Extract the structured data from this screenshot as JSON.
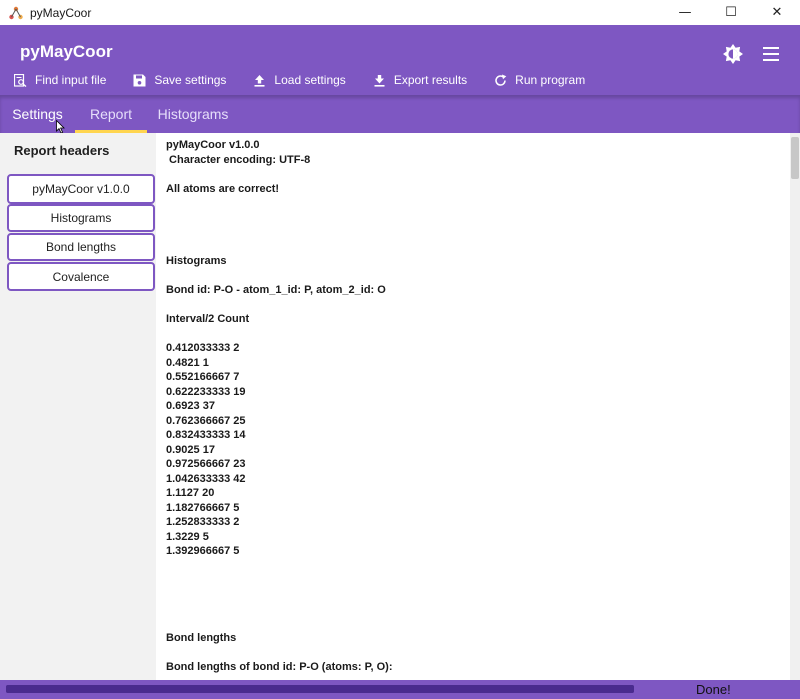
{
  "window": {
    "title": "pyMayCoor",
    "controls": [
      "—",
      "☐",
      "✕"
    ]
  },
  "header": {
    "title": "pyMayCoor",
    "theme_icon": "brightness-icon",
    "menu_icon": "hamburger-menu-icon",
    "accent_color": "#7e57c2"
  },
  "toolbar": {
    "find_label": "Find input file",
    "save_label": "Save settings",
    "load_label": "Load settings",
    "export_label": "Export results",
    "run_label": "Run program"
  },
  "tabs": [
    {
      "label": "Settings"
    },
    {
      "label": "Report"
    },
    {
      "label": "Histograms"
    }
  ],
  "active_tab": "Report",
  "sidebar": {
    "heading": "Report headers",
    "items": [
      {
        "label": "pyMayCoor v1.0.0"
      },
      {
        "label": "Histograms"
      },
      {
        "label": "Bond lengths"
      },
      {
        "label": "Covalence"
      }
    ]
  },
  "report": {
    "lines": [
      "pyMayCoor v1.0.0",
      " Character encoding: UTF-8",
      "",
      "All atoms are correct!",
      "",
      "",
      "",
      "",
      "Histograms",
      "",
      "Bond id: P-O - atom_1_id: P, atom_2_id: O",
      "",
      "Interval/2 Count",
      "",
      "0.412033333 2",
      "0.4821 1",
      "0.552166667 7",
      "0.622233333 19",
      "0.6923 37",
      "0.762366667 25",
      "0.832433333 14",
      "0.9025 17",
      "0.972566667 23",
      "1.042633333 42",
      "1.1127 20",
      "1.182766667 5",
      "1.252833333 2",
      "1.3229 5",
      "1.392966667 5",
      "",
      "",
      "",
      "",
      "",
      "Bond lengths",
      "",
      "Bond lengths of bond id: P-O (atoms: P, O):"
    ]
  },
  "status": {
    "text": "Done!",
    "progress": 1.0
  }
}
